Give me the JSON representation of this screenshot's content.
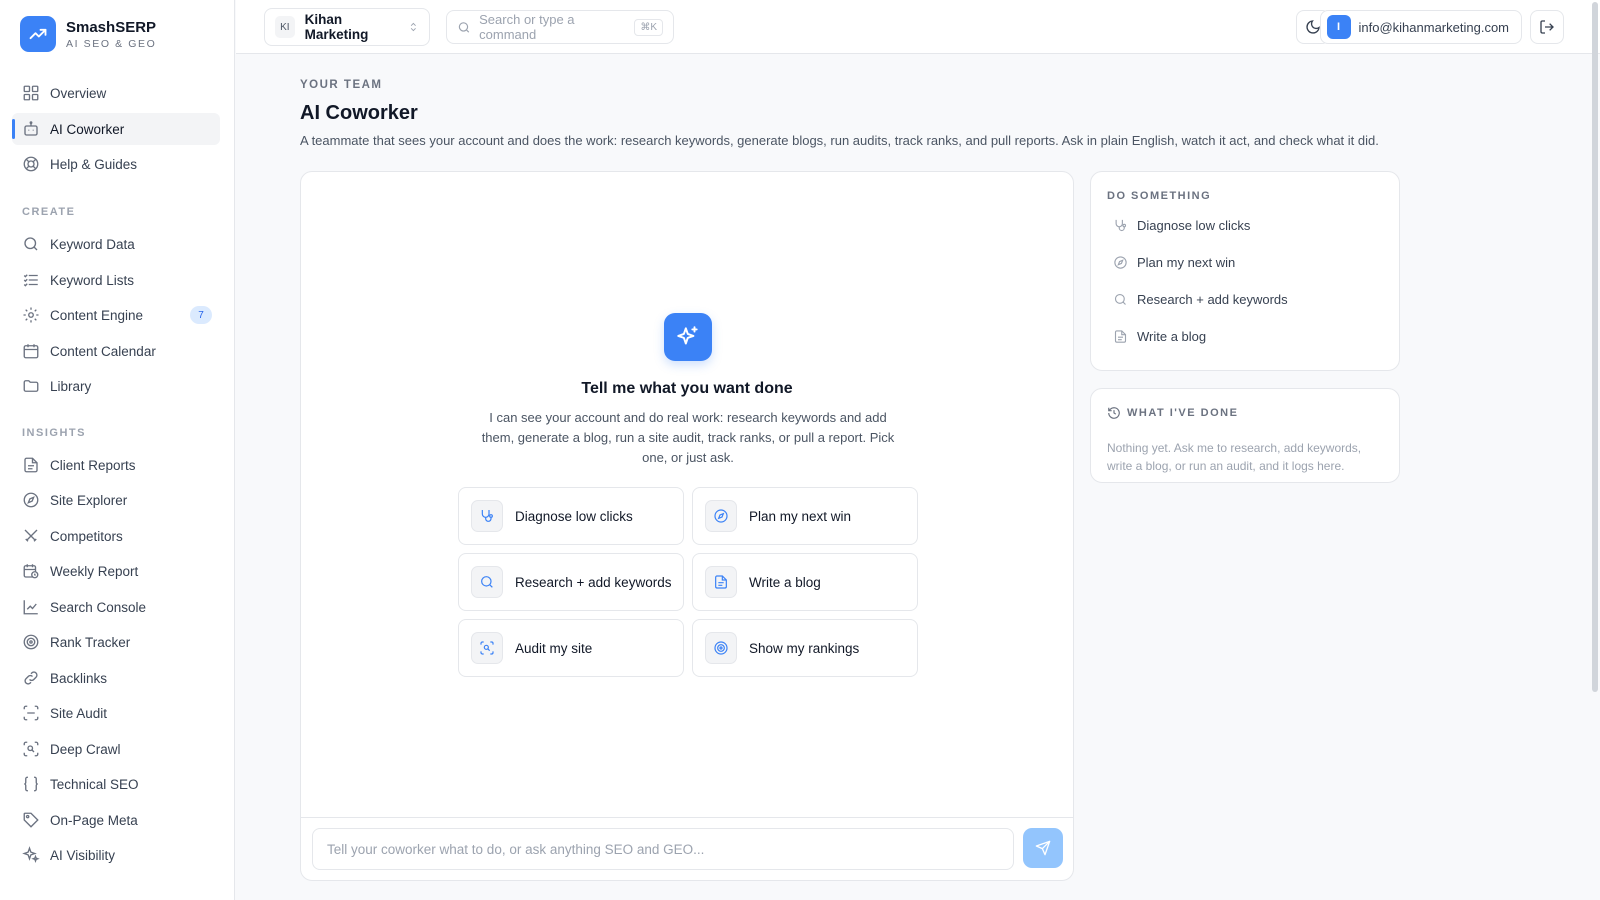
{
  "brand": {
    "name": "SmashSERP",
    "tagline": "AI SEO & GEO"
  },
  "sidebar": {
    "main": [
      {
        "label": "Overview",
        "icon": "grid-icon"
      },
      {
        "label": "AI Coworker",
        "icon": "bot-icon",
        "active": true
      },
      {
        "label": "Help & Guides",
        "icon": "lifebuoy-icon"
      }
    ],
    "create_heading": "CREATE",
    "create": [
      {
        "label": "Keyword Data",
        "icon": "search-icon"
      },
      {
        "label": "Keyword Lists",
        "icon": "list-icon"
      },
      {
        "label": "Content Engine",
        "icon": "gear-icon",
        "badge": "7"
      },
      {
        "label": "Content Calendar",
        "icon": "calendar-icon"
      },
      {
        "label": "Library",
        "icon": "folder-icon"
      }
    ],
    "insights_heading": "INSIGHTS",
    "insights": [
      {
        "label": "Client Reports",
        "icon": "document-icon"
      },
      {
        "label": "Site Explorer",
        "icon": "compass-icon"
      },
      {
        "label": "Competitors",
        "icon": "swords-icon"
      },
      {
        "label": "Weekly Report",
        "icon": "calendar-clock-icon"
      },
      {
        "label": "Search Console",
        "icon": "line-chart-icon"
      },
      {
        "label": "Rank Tracker",
        "icon": "target-icon"
      },
      {
        "label": "Backlinks",
        "icon": "link-icon"
      },
      {
        "label": "Site Audit",
        "icon": "scan-icon"
      },
      {
        "label": "Deep Crawl",
        "icon": "scan-search-icon"
      },
      {
        "label": "Technical SEO",
        "icon": "braces-icon"
      },
      {
        "label": "On-Page Meta",
        "icon": "tag-icon"
      },
      {
        "label": "AI Visibility",
        "icon": "sparkles-icon"
      }
    ]
  },
  "topbar": {
    "workspace_initials": "KI",
    "workspace_name": "Kihan Marketing",
    "search_placeholder": "Search or type a command",
    "search_shortcut": "⌘K",
    "user_initial": "I",
    "user_email": "info@kihanmarketing.com"
  },
  "page": {
    "eyebrow": "YOUR TEAM",
    "title": "AI Coworker",
    "description": "A teammate that sees your account and does the work: research keywords, generate blogs, run audits, track ranks, and pull reports. Ask in plain English, watch it act, and check what it did."
  },
  "chat": {
    "hero_title": "Tell me what you want done",
    "hero_description": "I can see your account and do real work: research keywords and add them, generate a blog, run a site audit, track ranks, or pull a report. Pick one, or just ask.",
    "quick_actions": [
      {
        "label": "Diagnose low clicks",
        "icon": "stethoscope-icon"
      },
      {
        "label": "Plan my next win",
        "icon": "compass-icon"
      },
      {
        "label": "Research + add keywords",
        "icon": "search-icon"
      },
      {
        "label": "Write a blog",
        "icon": "document-icon"
      },
      {
        "label": "Audit my site",
        "icon": "scan-search-icon"
      },
      {
        "label": "Show my rankings",
        "icon": "target-icon"
      }
    ],
    "input_placeholder": "Tell your coworker what to do, or ask anything SEO and GEO..."
  },
  "do_something": {
    "title": "DO SOMETHING",
    "items": [
      {
        "label": "Diagnose low clicks",
        "icon": "stethoscope-icon"
      },
      {
        "label": "Plan my next win",
        "icon": "compass-icon"
      },
      {
        "label": "Research + add keywords",
        "icon": "search-icon"
      },
      {
        "label": "Write a blog",
        "icon": "document-icon"
      }
    ]
  },
  "history": {
    "title": "WHAT I'VE DONE",
    "empty_text": "Nothing yet. Ask me to research, add keywords, write a blog, or run an audit, and it logs here."
  },
  "colors": {
    "accent": "#3b82f6",
    "accent_light": "#93c5fd",
    "border": "#e5e7eb"
  }
}
